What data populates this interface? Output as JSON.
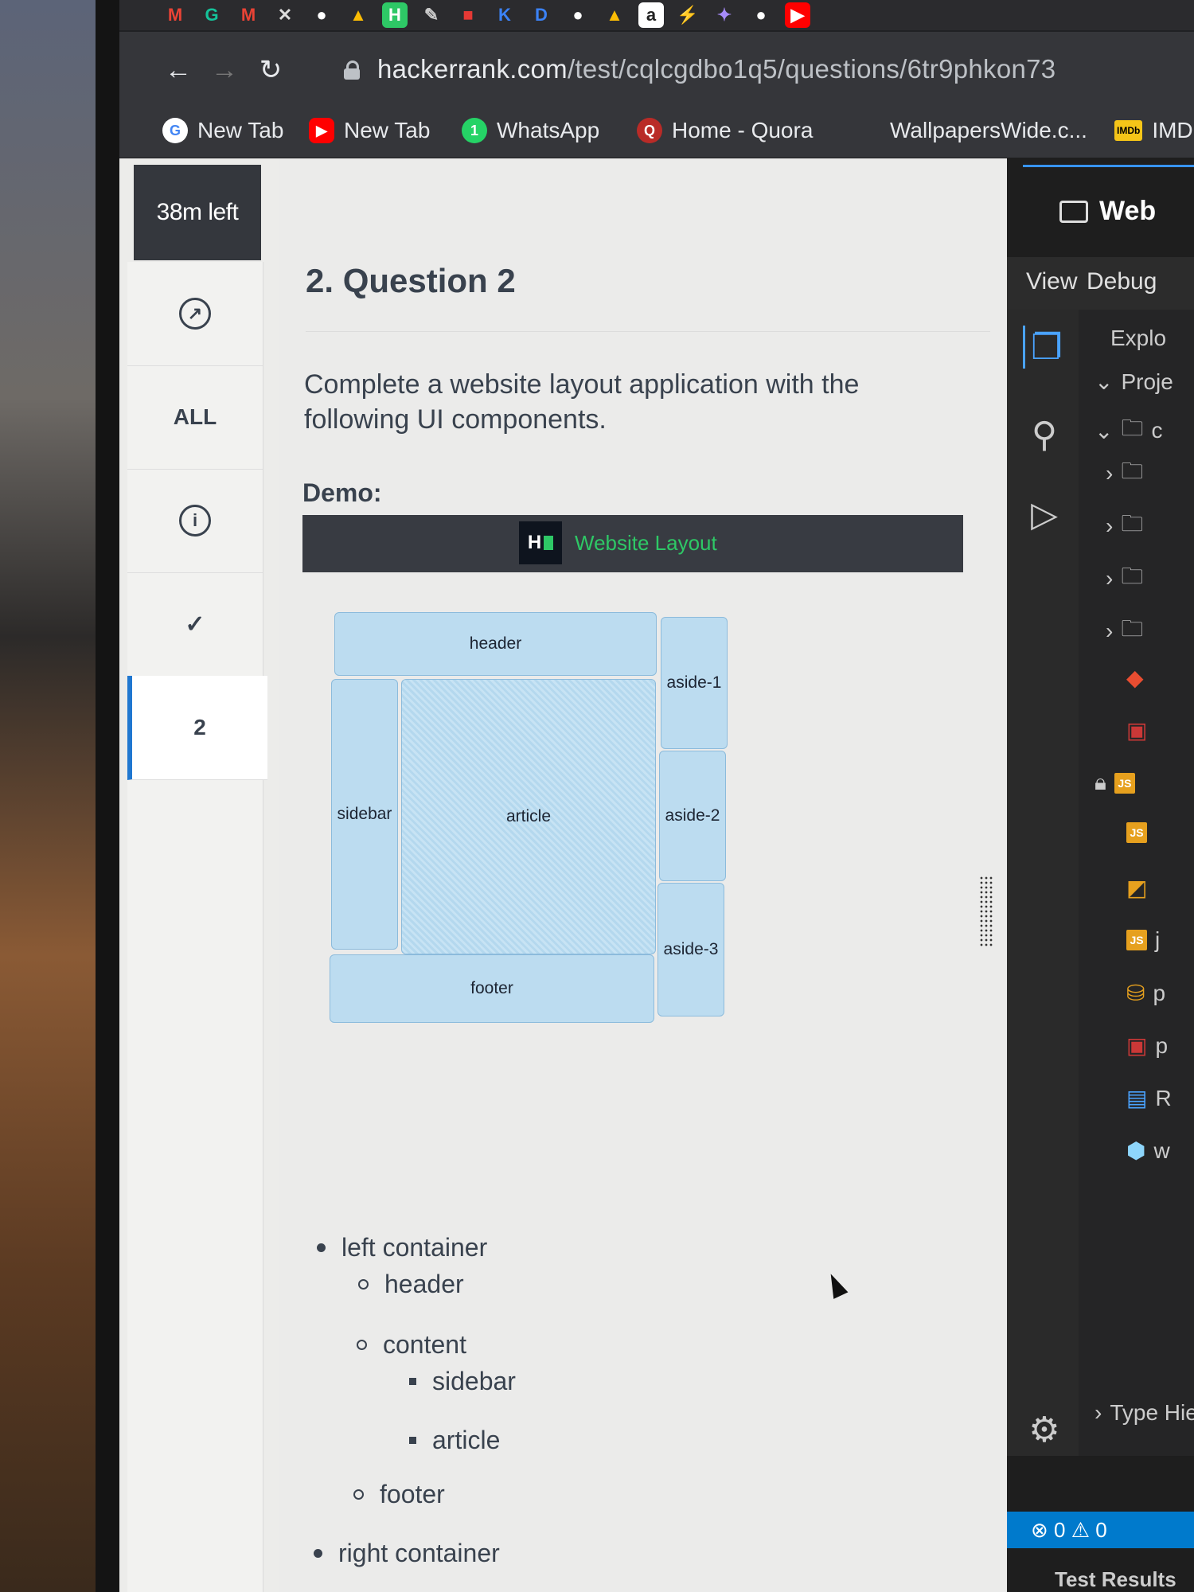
{
  "browser": {
    "url_host": "hackerrank.com",
    "url_path": "/test/cqlcgdbo1q5/questions/6tr9phkon73",
    "bookmarks": [
      {
        "label": "New Tab",
        "icon": "google-icon",
        "color": "#4285f4"
      },
      {
        "label": "New Tab",
        "icon": "youtube-icon",
        "color": "#ff0000"
      },
      {
        "label": "WhatsApp",
        "icon": "whatsapp-icon",
        "color": "#25d366"
      },
      {
        "label": "Home - Quora",
        "icon": "quora-icon",
        "color": "#b92b27"
      },
      {
        "label": "WallpapersWide.c...",
        "icon": "",
        "color": ""
      },
      {
        "label": "IMD",
        "icon": "imdb-icon",
        "color": "#f5c518"
      }
    ],
    "imdb_badge": "IMDb"
  },
  "test": {
    "time_left": "38m left",
    "rail": {
      "all": "ALL",
      "current": "2"
    },
    "question_title": "2. Question 2",
    "description": "Complete a website layout application with the following UI components.",
    "demo_label": "Demo:",
    "demo_app_title": "Website Layout",
    "demo_logo": "H",
    "layout_boxes": {
      "header": "header",
      "sidebar": "sidebar",
      "article": "article",
      "footer": "footer",
      "aside1": "aside-1",
      "aside2": "aside-2",
      "aside3": "aside-3"
    },
    "component_tree": {
      "left": "left container",
      "header": "header",
      "content": "content",
      "sidebar": "sidebar",
      "article": "article",
      "footer": "footer",
      "right": "right container"
    }
  },
  "ide": {
    "tab_title": "Web",
    "menu": [
      "View",
      "Debug"
    ],
    "explorer_title": "Explo",
    "project_label": "Proje",
    "folder_c": "c",
    "file_letters": [
      "j",
      "p",
      "p",
      "R",
      "w"
    ],
    "js_badge": "JS",
    "type_hierarchy": "Type Hie",
    "errors": "0",
    "warnings": "0",
    "test_results": "Test Results"
  }
}
